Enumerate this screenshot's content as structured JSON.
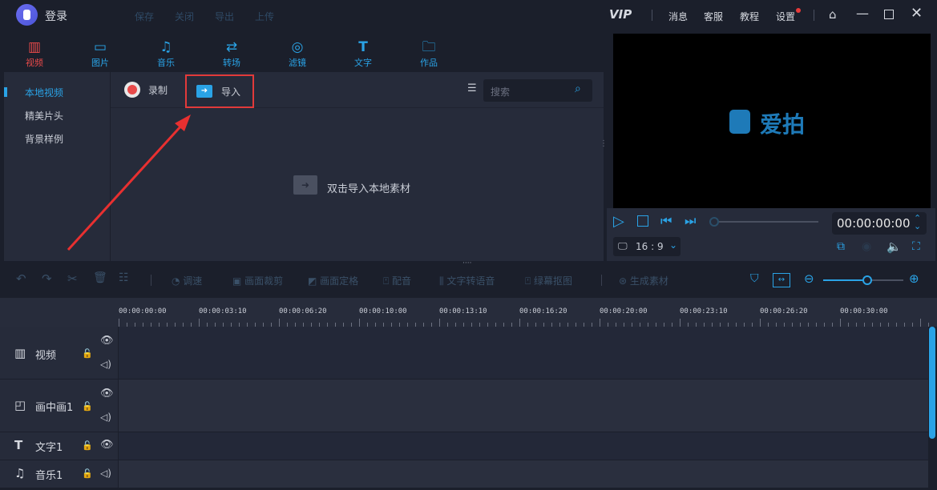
{
  "titlebar": {
    "login": "登录",
    "menu": [
      "保存",
      "关闭",
      "导出",
      "上传"
    ],
    "vip": "VIP",
    "right": [
      "消息",
      "客服",
      "教程",
      "设置"
    ]
  },
  "tabs": [
    {
      "label": "视频",
      "icon": "film-icon"
    },
    {
      "label": "图片",
      "icon": "image-icon"
    },
    {
      "label": "音乐",
      "icon": "music-icon"
    },
    {
      "label": "转场",
      "icon": "transition-icon"
    },
    {
      "label": "滤镜",
      "icon": "filter-icon"
    },
    {
      "label": "文字",
      "icon": "text-icon"
    },
    {
      "label": "作品",
      "icon": "folder-icon"
    }
  ],
  "sidebar": [
    "本地视频",
    "精美片头",
    "背景样例"
  ],
  "media": {
    "record": "录制",
    "import": "导入",
    "search_placeholder": "搜索",
    "empty_hint": "双击导入本地素材"
  },
  "preview": {
    "brand": "爱拍",
    "time": "00:00:00:00",
    "ratio": "16 : 9"
  },
  "edit_toolbar": [
    "调速",
    "画面裁剪",
    "画面定格",
    "配音",
    "文字转语音",
    "绿幕抠图",
    "生成素材"
  ],
  "zoom_level": 0.55,
  "ruler": [
    "00:00:00:00",
    "00:00:03:10",
    "00:00:06:20",
    "00:00:10:00",
    "00:00:13:10",
    "00:00:16:20",
    "00:00:20:00",
    "00:00:23:10",
    "00:00:26:20",
    "00:00:30:00"
  ],
  "tracks": [
    "视频",
    "画中画1",
    "文字1",
    "音乐1"
  ]
}
